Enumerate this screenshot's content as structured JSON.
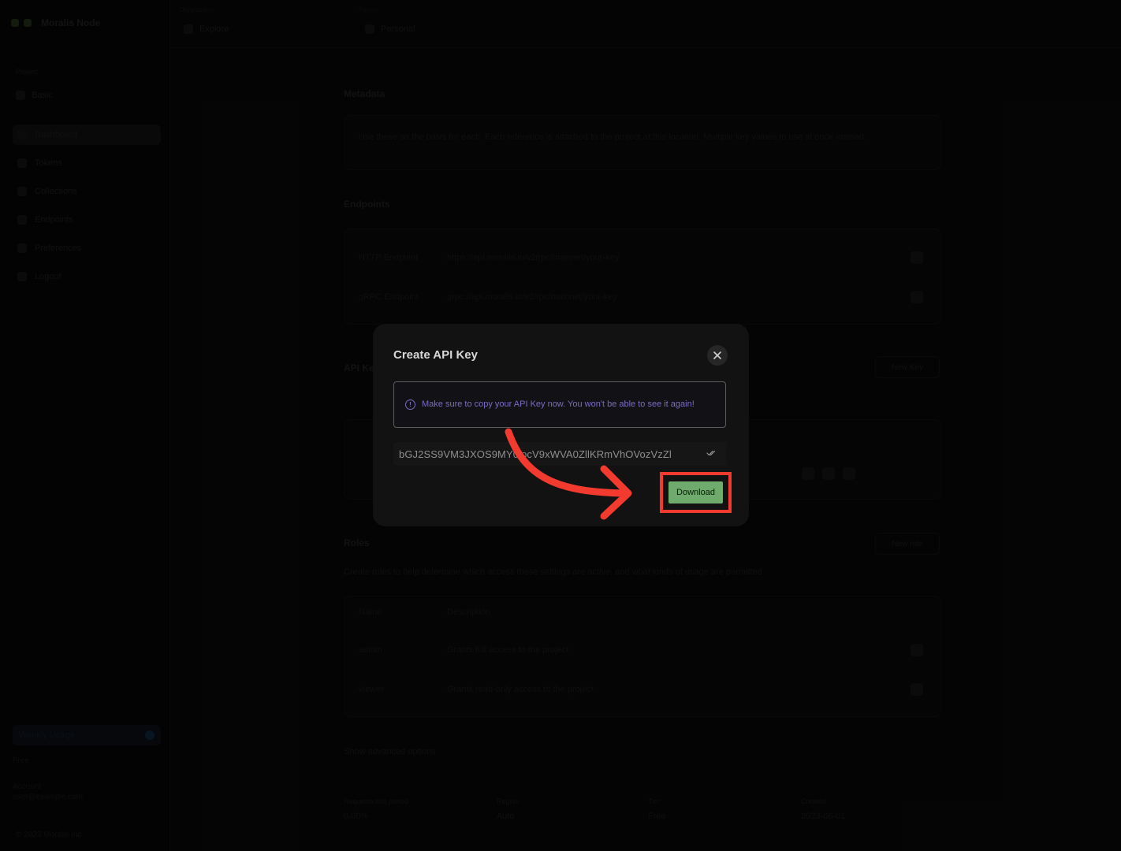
{
  "app": {
    "brand": "Moralis Node",
    "sidebar": {
      "section_label": "Project",
      "project": "Basic",
      "items": [
        {
          "label": "Dashboard",
          "active": true
        },
        {
          "label": "Tokens"
        },
        {
          "label": "Collections"
        },
        {
          "label": "Endpoints"
        },
        {
          "label": "Preferences"
        },
        {
          "label": "Logout"
        }
      ],
      "usage": "Weekly Usage",
      "plan": "Free",
      "user_name": "Account",
      "user_email": "user@example.com",
      "copyright": "© 2023 Moralis Inc"
    },
    "topbar": {
      "crumb1": "Organization",
      "select1": "Explore",
      "crumb2": "Project",
      "select2": "Personal"
    },
    "content": {
      "metadata_title": "Metadata",
      "metadata_text": "Use these as the basis for each. Each reference is attached to the project at this location. Multiple key values to use at once instead.",
      "endpoints_title": "Endpoints",
      "endpoint_rows": [
        {
          "label": "HTTP Endpoint",
          "value": "https://api.moralis.io/v2/rpc/mainnet/your-key"
        },
        {
          "label": "gRPC Endpoint",
          "value": "grpc://api.moralis.io/v2/rpc/mainnet/your-key"
        }
      ],
      "api_keys_title": "API Keys",
      "api_keys_new": "New Key",
      "roles_title": "Roles",
      "roles_new": "New role",
      "roles_desc": "Create roles to help determine which access these settings are active, and what kinds of usage are permitted.",
      "roles_headers": [
        "Name",
        "Description"
      ],
      "roles_rows": [
        {
          "name": "admin",
          "desc": "Grants full access to the project"
        },
        {
          "name": "viewer",
          "desc": "Grants read-only access to the project"
        }
      ],
      "advanced_toggle": "Show advanced options",
      "stats": [
        {
          "label": "Requests this period",
          "value": "0.00%"
        },
        {
          "label": "Region",
          "value": "Auto"
        },
        {
          "label": "Tier",
          "value": "Free"
        },
        {
          "label": "Created",
          "value": "2023-06-01"
        }
      ]
    }
  },
  "modal": {
    "title": "Create API Key",
    "close_icon": "close-icon",
    "alert_icon": "info-circle-icon",
    "alert_text": "Make sure to copy your API Key now. You won't be able to see it again!",
    "api_key": "bGJ2SS9VM3JXOS9MY0locV9xWVA0ZllKRmVhOVozVzZl",
    "copy_icon": "double-check-icon",
    "download_label": "Download"
  },
  "colors": {
    "modal_bg": "#121212",
    "alert_text": "#7a6cc0",
    "download_bg": "#6fab6c",
    "annotation_red": "#f23a2f"
  }
}
